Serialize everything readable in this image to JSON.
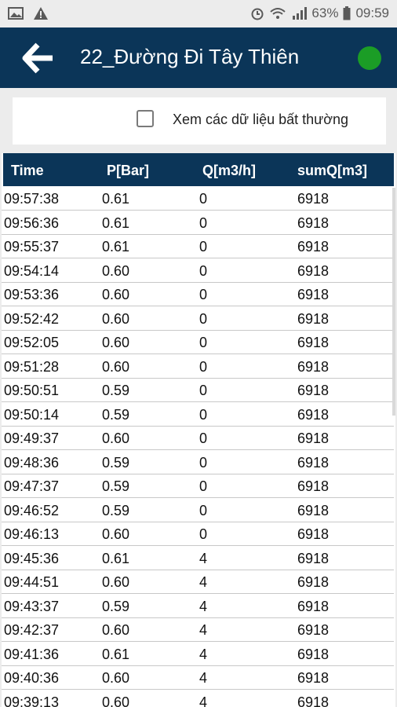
{
  "status_bar": {
    "battery": "63%",
    "time": "09:59",
    "icons": [
      "image-icon",
      "warning-icon",
      "alarm-icon",
      "wifi-icon",
      "signal-icon",
      "battery-icon"
    ]
  },
  "header": {
    "title": "22_Đường Đi Tây Thiên",
    "status_color": "#1b9d26"
  },
  "filter": {
    "label": "Xem các dữ liệu bất thường",
    "checked": false
  },
  "table": {
    "columns": [
      "Time",
      "P[Bar]",
      "Q[m3/h]",
      "sumQ[m3]"
    ],
    "rows": [
      [
        "09:57:38",
        "0.61",
        "0",
        "6918"
      ],
      [
        "09:56:36",
        "0.61",
        "0",
        "6918"
      ],
      [
        "09:55:37",
        "0.61",
        "0",
        "6918"
      ],
      [
        "09:54:14",
        "0.60",
        "0",
        "6918"
      ],
      [
        "09:53:36",
        "0.60",
        "0",
        "6918"
      ],
      [
        "09:52:42",
        "0.60",
        "0",
        "6918"
      ],
      [
        "09:52:05",
        "0.60",
        "0",
        "6918"
      ],
      [
        "09:51:28",
        "0.60",
        "0",
        "6918"
      ],
      [
        "09:50:51",
        "0.59",
        "0",
        "6918"
      ],
      [
        "09:50:14",
        "0.59",
        "0",
        "6918"
      ],
      [
        "09:49:37",
        "0.60",
        "0",
        "6918"
      ],
      [
        "09:48:36",
        "0.59",
        "0",
        "6918"
      ],
      [
        "09:47:37",
        "0.59",
        "0",
        "6918"
      ],
      [
        "09:46:52",
        "0.59",
        "0",
        "6918"
      ],
      [
        "09:46:13",
        "0.60",
        "0",
        "6918"
      ],
      [
        "09:45:36",
        "0.61",
        "4",
        "6918"
      ],
      [
        "09:44:51",
        "0.60",
        "4",
        "6918"
      ],
      [
        "09:43:37",
        "0.59",
        "4",
        "6918"
      ],
      [
        "09:42:37",
        "0.60",
        "4",
        "6918"
      ],
      [
        "09:41:36",
        "0.61",
        "4",
        "6918"
      ],
      [
        "09:40:36",
        "0.60",
        "4",
        "6918"
      ],
      [
        "09:39:13",
        "0.60",
        "4",
        "6918"
      ]
    ]
  }
}
